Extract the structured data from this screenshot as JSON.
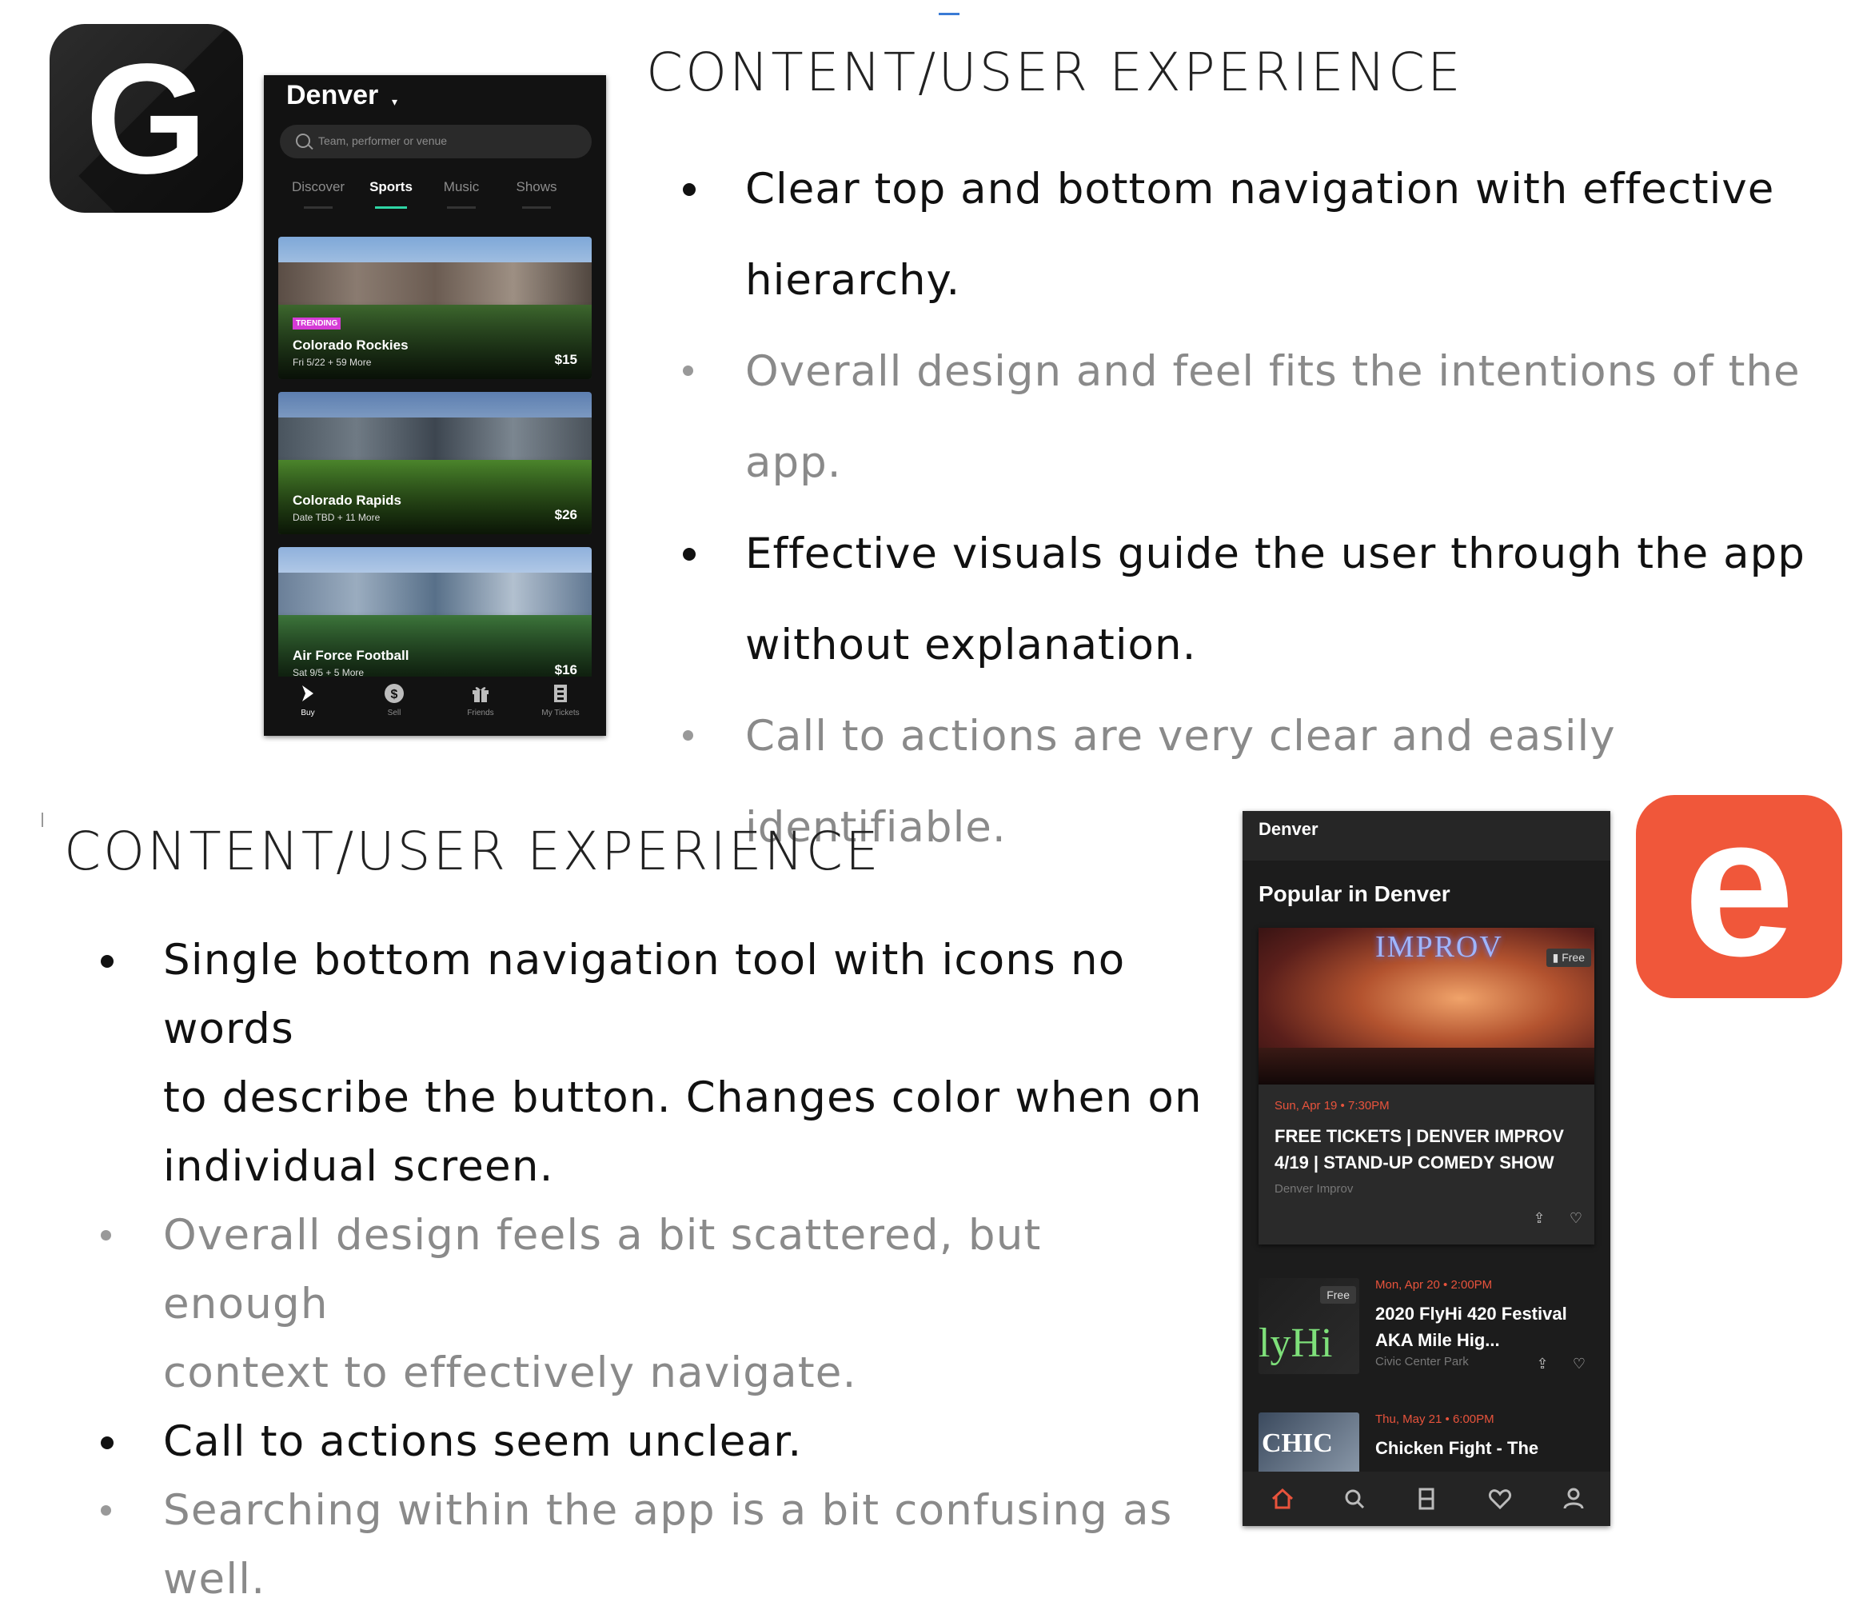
{
  "top": {
    "heading": "CONTENT/USER EXPERIENCE",
    "bullets": [
      {
        "text": "Clear top and bottom navigation with effective",
        "tone": "dark"
      },
      {
        "text": "hierarchy.",
        "tone": "dark",
        "continuation": true
      },
      {
        "text": "Overall design and feel fits the intentions of the app.",
        "tone": "grey"
      },
      {
        "text": "Effective visuals guide the user through the app",
        "tone": "dark"
      },
      {
        "text": "without explanation.",
        "tone": "dark",
        "continuation": true
      },
      {
        "text": "Call to actions are very clear and easily identifiable.",
        "tone": "grey"
      }
    ]
  },
  "bottom": {
    "heading": "CONTENT/USER EXPERIENCE",
    "bullets": [
      {
        "text": "Single bottom navigation tool with icons no words",
        "tone": "dark"
      },
      {
        "text": "to describe the button. Changes color when on",
        "tone": "dark",
        "continuation": true
      },
      {
        "text": "individual screen.",
        "tone": "dark",
        "continuation": true
      },
      {
        "text": "Overall design feels a bit scattered, but enough",
        "tone": "grey"
      },
      {
        "text": "context to effectively navigate.",
        "tone": "grey",
        "continuation": true
      },
      {
        "text": "Call to actions seem unclear.",
        "tone": "dark"
      },
      {
        "text": "Searching within the app is a bit confusing as well.",
        "tone": "grey"
      }
    ]
  },
  "gametime_icon": {
    "letter": "G",
    "icon": "gametime-logo-icon"
  },
  "eventbrite_icon": {
    "letter": "e",
    "icon": "eventbrite-logo-icon",
    "color": "#f0573a"
  },
  "gametime": {
    "city": "Denver",
    "search_placeholder": "Team, performer or venue",
    "tabs": [
      {
        "label": "Discover",
        "active": false
      },
      {
        "label": "Sports",
        "active": true
      },
      {
        "label": "Music",
        "active": false
      },
      {
        "label": "Shows",
        "active": false
      }
    ],
    "accent": "#2fd5a5",
    "trending_color": "#d53bd6",
    "events": [
      {
        "name": "Colorado Rockies",
        "date": "Fri 5/22 + 59 More",
        "price": "$15",
        "tag": "TRENDING"
      },
      {
        "name": "Colorado Rapids",
        "date": "Date TBD + 11 More",
        "price": "$26",
        "tag": ""
      },
      {
        "name": "Air Force Football",
        "date": "Sat 9/5 + 5 More",
        "price": "$16",
        "tag": ""
      }
    ],
    "nav": [
      {
        "label": "Buy",
        "icon": "buy-arrow-icon",
        "active": true
      },
      {
        "label": "Sell",
        "icon": "dollar-coin-icon",
        "active": false
      },
      {
        "label": "Friends",
        "icon": "gift-icon",
        "active": false
      },
      {
        "label": "My Tickets",
        "icon": "ticket-icon",
        "active": false
      }
    ]
  },
  "eventbrite": {
    "city": "Denver",
    "section": "Popular in Denver",
    "featured": {
      "sign": "IMPROV",
      "badge": "Free",
      "when": "Sun, Apr 19 • 7:30PM",
      "title": "FREE TICKETS | DENVER IMPROV 4/19 | STAND-UP COMEDY SHOW",
      "venue": "Denver Improv"
    },
    "events": [
      {
        "when": "Mon, Apr 20 • 2:00PM",
        "title": "2020 FlyHi 420 Festival AKA Mile Hig...",
        "venue": "Civic Center Park",
        "badge": "Free",
        "thumb_text": "lyHi"
      },
      {
        "when": "Thu, May 21 • 6:00PM",
        "title": "Chicken Fight - The",
        "venue": "",
        "badge": "",
        "thumb_text": "CHIC"
      }
    ],
    "accent": "#e8533c",
    "nav": [
      {
        "icon": "home-icon",
        "active": true
      },
      {
        "icon": "search-icon",
        "active": false
      },
      {
        "icon": "ticket-icon",
        "active": false
      },
      {
        "icon": "heart-icon",
        "active": false
      },
      {
        "icon": "profile-icon",
        "active": false
      }
    ]
  }
}
